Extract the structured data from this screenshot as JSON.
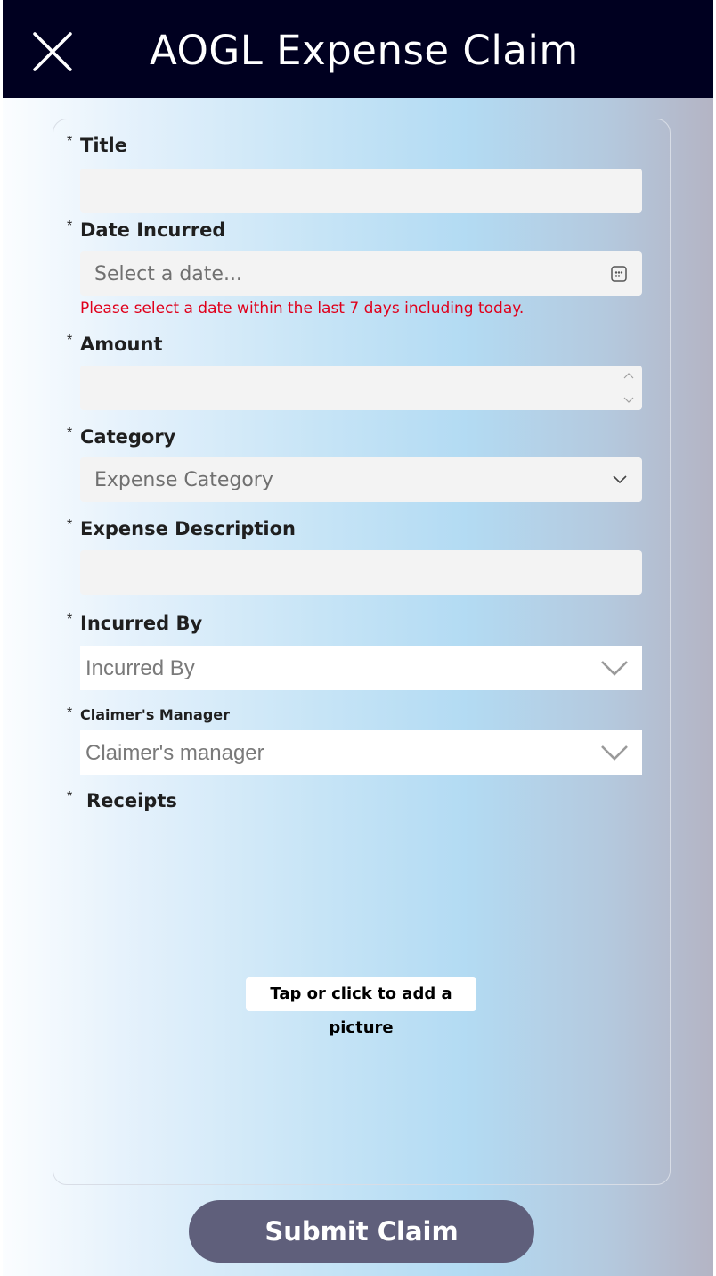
{
  "header": {
    "title": "AOGL Expense Claim",
    "close_icon": "close-icon"
  },
  "form": {
    "required_marker": "*",
    "title": {
      "label": "Title",
      "value": ""
    },
    "date_incurred": {
      "label": "Date Incurred",
      "placeholder": "Select a date...",
      "icon": "calendar-icon",
      "error": "Please select a date within the last 7 days including today."
    },
    "amount": {
      "label": "Amount",
      "value": ""
    },
    "category": {
      "label": "Category",
      "placeholder": "Expense Category",
      "icon": "chevron-down-icon"
    },
    "expense_description": {
      "label": "Expense Description",
      "value": ""
    },
    "incurred_by": {
      "label": "Incurred By",
      "placeholder": "Incurred By",
      "icon": "chevron-down-icon"
    },
    "claimers_manager": {
      "label": "Claimer's Manager",
      "placeholder": "Claimer's manager",
      "icon": "chevron-down-icon"
    },
    "receipts": {
      "label": "Receipts",
      "add_picture_label": "Tap or click to add a picture"
    }
  },
  "submit_label": "Submit Claim",
  "colors": {
    "header_bg": "#000020",
    "submit_bg": "#5f5f7b",
    "error": "#e0001b",
    "field_bg": "#f3f3f3"
  }
}
